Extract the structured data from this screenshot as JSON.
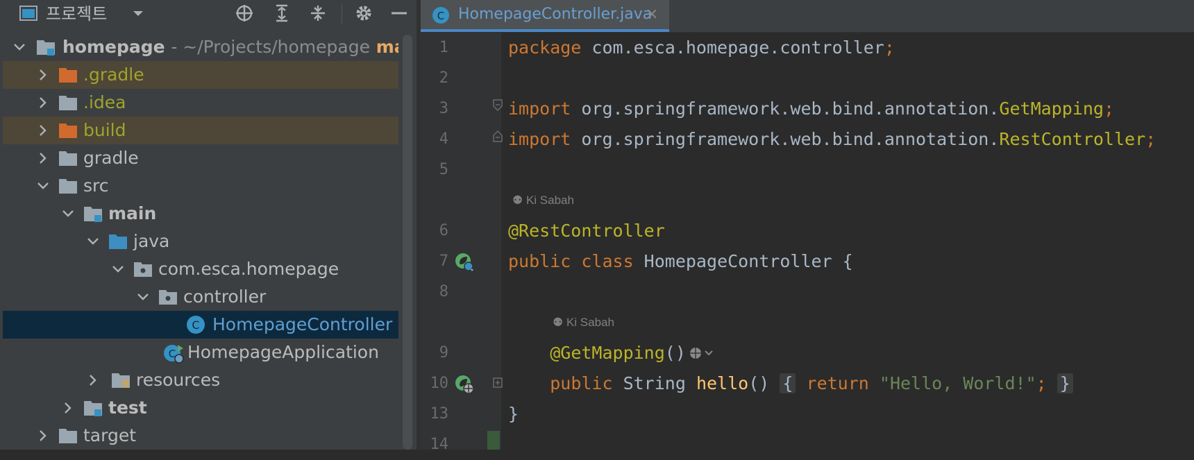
{
  "project_panel": {
    "title": "프로젝트",
    "icons": [
      "project-view-icon",
      "dropdown-arrow-icon",
      "locate-icon",
      "expand-all-icon",
      "collapse-all-icon",
      "settings-icon",
      "minimize-icon"
    ]
  },
  "tree": {
    "root": {
      "label": "homepage",
      "path": "- ~/Projects/homepage",
      "branch": "ma"
    },
    "items": [
      {
        "label": ".gradle"
      },
      {
        "label": ".idea"
      },
      {
        "label": "build"
      },
      {
        "label": "gradle"
      },
      {
        "label": "src"
      },
      {
        "label": "main"
      },
      {
        "label": "java"
      },
      {
        "label": "com.esca.homepage"
      },
      {
        "label": "controller"
      },
      {
        "label": "HomepageController"
      },
      {
        "label": "HomepageApplication"
      },
      {
        "label": "resources"
      },
      {
        "label": "test"
      },
      {
        "label": "target"
      }
    ]
  },
  "editor_tab": {
    "label": "HomepageController.java",
    "close": "×"
  },
  "editor": {
    "line_numbers": [
      "1",
      "2",
      "3",
      "4",
      "5",
      "6",
      "7",
      "8",
      "9",
      "10",
      "13",
      "14"
    ],
    "lines": {
      "l1_kw": "package",
      "l1_rest": " com.esca.homepage.controller",
      "l1_semi": ";",
      "l3_kw": "import",
      "l3_rest": " org.springframework.web.bind.annotation.",
      "l3_cls": "GetMapping",
      "l3_semi": ";",
      "l4_kw": "import",
      "l4_rest": " org.springframework.web.bind.annotation.",
      "l4_cls": "RestController",
      "l4_semi": ";",
      "l6_ann": "@RestController",
      "l7_kw": "public class",
      "l7_rest": " HomepageController {",
      "l9_ann": "@GetMapping",
      "l9_paren": "()",
      "l10_kw": "public",
      "l10_type": " String ",
      "l10_fn": "hello",
      "l10_paren": "()",
      "l10_open": "{",
      "l10_ret": "return",
      "l10_str": "\"Hello, World!\"",
      "l10_semi": ";",
      "l10_close": "}",
      "l13": "}"
    },
    "inlay_author_1": "Ki Sabah",
    "inlay_author_2": "Ki Sabah"
  },
  "colors": {
    "keyword": "#cc7832",
    "annotation": "#bbb529",
    "string": "#6a8759",
    "method": "#ffc66d",
    "accent": "#4a88c7"
  }
}
